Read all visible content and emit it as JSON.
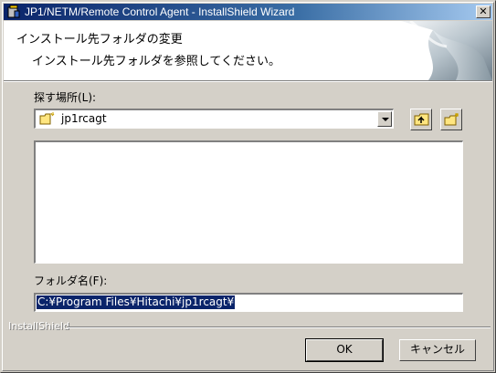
{
  "window": {
    "title": "JP1/NETM/Remote Control Agent - InstallShield Wizard",
    "close_glyph": "✕"
  },
  "header": {
    "title": "インストール先フォルダの変更",
    "subtitle": "インストール先フォルダを参照してください。"
  },
  "look_in": {
    "label": "探す場所(L):",
    "value": "jp1rcagt",
    "icon": "folder-icon"
  },
  "toolbar": {
    "up_icon": "folder-up-icon",
    "new_folder_icon": "new-folder-icon"
  },
  "folder_name": {
    "label": "フォルダ名(F):",
    "value": "C:¥Program Files¥Hitachi¥jp1rcagt¥"
  },
  "brand": "InstallShield",
  "buttons": {
    "ok": "OK",
    "cancel": "キャンセル"
  },
  "colors": {
    "titlebar_start": "#0a246a",
    "titlebar_end": "#a6caf0",
    "selection": "#0a246a",
    "face": "#d4d0c8"
  }
}
